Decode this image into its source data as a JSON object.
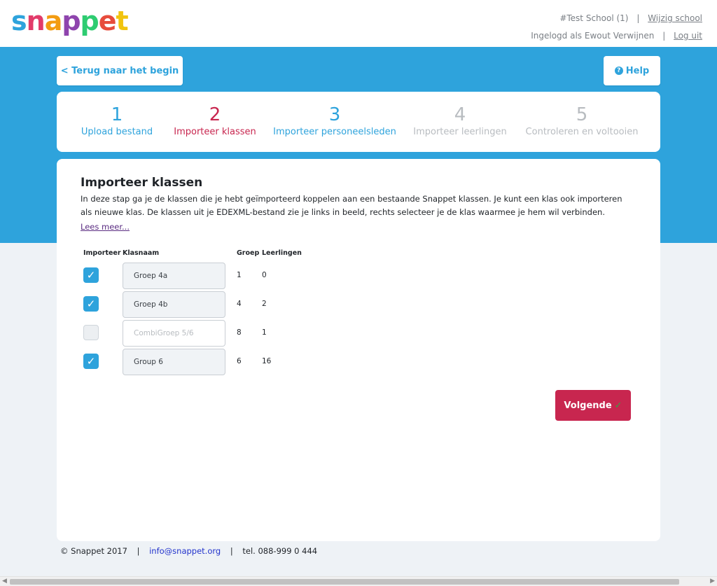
{
  "logo": {
    "letters": [
      {
        "ch": "s",
        "color": "#2ea3dc"
      },
      {
        "ch": "n",
        "color": "#e23b6a"
      },
      {
        "ch": "a",
        "color": "#f39c12"
      },
      {
        "ch": "p",
        "color": "#8e44ad"
      },
      {
        "ch": "p",
        "color": "#2ecc71"
      },
      {
        "ch": "e",
        "color": "#e74c3c"
      },
      {
        "ch": "t",
        "color": "#f1c40f"
      }
    ]
  },
  "header": {
    "school": "#Test School (1)",
    "change_school": "Wijzig school",
    "logged_in": "Ingelogd als Ewout Verwijnen",
    "logout": "Log uit"
  },
  "nav": {
    "back": "< Terug naar het begin",
    "help": "Help",
    "help_icon": "question-circle-icon"
  },
  "steps": [
    {
      "num": "1",
      "label": "Upload bestand",
      "state": "done"
    },
    {
      "num": "2",
      "label": "Importeer klassen",
      "state": "current"
    },
    {
      "num": "3",
      "label": "Importeer personeelsleden",
      "state": "done"
    },
    {
      "num": "4",
      "label": "Importeer leerlingen",
      "state": "todo"
    },
    {
      "num": "5",
      "label": "Controleren en voltooien",
      "state": "todo"
    }
  ],
  "main": {
    "title": "Importeer klassen",
    "intro": "In deze stap ga je de klassen die je hebt geïmporteerd koppelen aan een bestaande Snappet klassen. Je kunt een klas ook importeren als nieuwe klas. De klassen uit je EDEXML-bestand zie je links in beeld, rechts selecteer je de klas waarmee je hem wil verbinden.",
    "read_more": "Lees meer..."
  },
  "table": {
    "headers": [
      "Importeer",
      "Klasnaam",
      "Groep",
      "Leerlingen"
    ],
    "rows": [
      {
        "checked": true,
        "name": "Groep 4a",
        "group": "1",
        "students": "0"
      },
      {
        "checked": true,
        "name": "Groep 4b",
        "group": "4",
        "students": "2"
      },
      {
        "checked": false,
        "name": "CombiGroep 5/6",
        "group": "8",
        "students": "1"
      },
      {
        "checked": true,
        "name": "Group 6",
        "group": "6",
        "students": "16"
      }
    ]
  },
  "next_button": {
    "label": "Volgende",
    "icon": "✓"
  },
  "footer": {
    "copyright": "© Snappet 2017",
    "email": "info@snappet.org",
    "phone": "tel. 088-999 0 444"
  },
  "colors": {
    "primary_blue": "#2ea3dc",
    "accent_red": "#c8264f",
    "inactive_gray": "#b8bcc0"
  }
}
